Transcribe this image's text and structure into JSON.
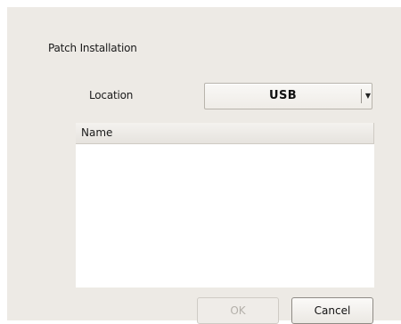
{
  "dialog": {
    "title": "Patch Installation"
  },
  "location": {
    "label": "Location",
    "selected": "USB",
    "dropdown_icon": "chevron-down-icon"
  },
  "table": {
    "columns": [
      "Name"
    ],
    "rows": []
  },
  "buttons": {
    "ok_label": "OK",
    "ok_enabled": false,
    "cancel_label": "Cancel"
  },
  "colors": {
    "dialog_background": "#edeae5",
    "list_background": "#ffffff",
    "disabled_text": "#b4b0aa"
  }
}
